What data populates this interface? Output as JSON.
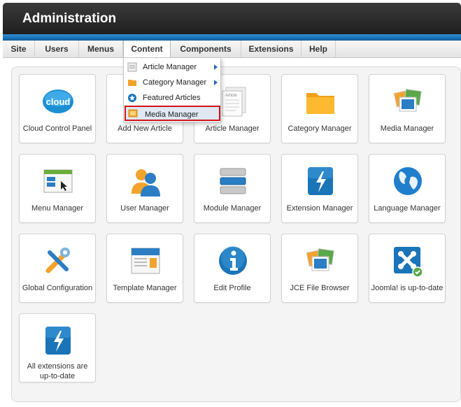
{
  "header": {
    "title": "Administration"
  },
  "menu": {
    "items": [
      {
        "label": "Site"
      },
      {
        "label": "Users"
      },
      {
        "label": "Menus"
      },
      {
        "label": "Content"
      },
      {
        "label": "Components"
      },
      {
        "label": "Extensions"
      },
      {
        "label": "Help"
      }
    ],
    "active": "Content"
  },
  "dropdown": {
    "items": [
      {
        "label": "Article Manager",
        "icon": "article-icon",
        "submenu": true
      },
      {
        "label": "Category Manager",
        "icon": "folder-icon",
        "submenu": true
      },
      {
        "label": "Featured Articles",
        "icon": "star-icon",
        "submenu": false
      },
      {
        "label": "Media Manager",
        "icon": "media-icon",
        "submenu": false,
        "highlighted": true
      }
    ]
  },
  "tiles": [
    {
      "label": "Cloud Control Panel",
      "icon": "cloud-icon"
    },
    {
      "label": "Add New Article",
      "icon": "new-article-icon"
    },
    {
      "label": "Article Manager",
      "icon": "article-manager-icon"
    },
    {
      "label": "Category Manager",
      "icon": "folder-icon"
    },
    {
      "label": "Media Manager",
      "icon": "media-icon"
    },
    {
      "label": "Menu Manager",
      "icon": "menu-manager-icon"
    },
    {
      "label": "User Manager",
      "icon": "users-icon"
    },
    {
      "label": "Module Manager",
      "icon": "module-icon"
    },
    {
      "label": "Extension Manager",
      "icon": "lightning-icon"
    },
    {
      "label": "Language Manager",
      "icon": "globe-icon"
    },
    {
      "label": "Global Configuration",
      "icon": "tools-icon"
    },
    {
      "label": "Template Manager",
      "icon": "template-icon"
    },
    {
      "label": "Edit Profile",
      "icon": "info-icon"
    },
    {
      "label": "JCE File Browser",
      "icon": "file-browser-icon"
    },
    {
      "label": "Joomla! is up-to-date",
      "icon": "joomla-icon"
    },
    {
      "label": "All extensions are up-to-date",
      "icon": "lightning-icon"
    }
  ],
  "colors": {
    "header": "#1f1f1f",
    "stripe": "#1a78c2",
    "highlight_border": "#d0141a"
  }
}
